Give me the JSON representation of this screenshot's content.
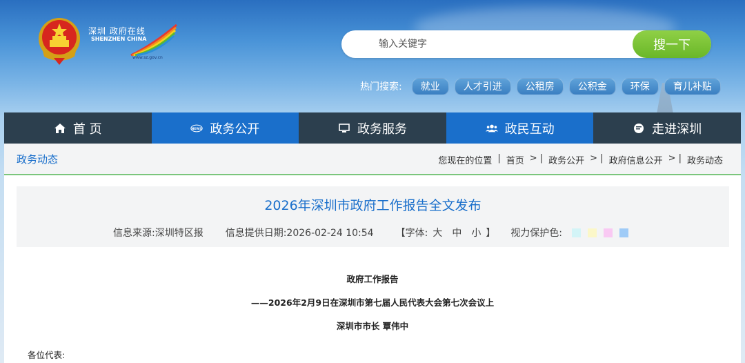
{
  "header": {
    "logo_cn": "深圳 政府在线",
    "logo_en": "SHENZHEN CHINA",
    "logo_url": "www.sz.gov.cn",
    "search": {
      "placeholder": "输入关键字",
      "button_label": "搜一下"
    },
    "hot_search": {
      "label": "热门搜索:",
      "tags": [
        "就业",
        "人才引进",
        "公租房",
        "公积金",
        "环保",
        "育儿补贴"
      ]
    }
  },
  "nav": {
    "items": [
      {
        "label": "首 页",
        "icon": "home-icon"
      },
      {
        "label": "政务公开",
        "icon": "news-icon"
      },
      {
        "label": "政务服务",
        "icon": "monitor-icon"
      },
      {
        "label": "政民互动",
        "icon": "people-icon"
      },
      {
        "label": "走进深圳",
        "icon": "chat-icon"
      }
    ]
  },
  "breadcrumb": {
    "section": "政务动态",
    "prefix": "您现在的位置",
    "items": [
      "首页",
      "政务公开",
      "政府信息公开",
      "政务动态"
    ]
  },
  "article": {
    "title": "2026年深圳市政府工作报告全文发布",
    "source": "信息来源:深圳特区报",
    "date": "信息提供日期:2026-02-24 10:54",
    "font_label_open": "【字体:",
    "font_sizes": [
      "大",
      "中",
      "小"
    ],
    "font_label_close": "】",
    "eye_care_label": "视力保护色:",
    "eye_care_colors": [
      "#d3f4f7",
      "#fbf7c8",
      "#f9c9f3",
      "#9fcbf7"
    ],
    "lines": [
      "政府工作报告",
      "——2026年2月9日在深圳市第七届人民代表大会第七次会议上",
      "深圳市市长 覃伟中"
    ],
    "greeting": "各位代表:"
  },
  "colors": {
    "nav_dark": "#2c3f4e",
    "nav_blue": "#1a6fcb",
    "search_green": "#7cc43a",
    "title_blue": "#1a6fcb"
  }
}
